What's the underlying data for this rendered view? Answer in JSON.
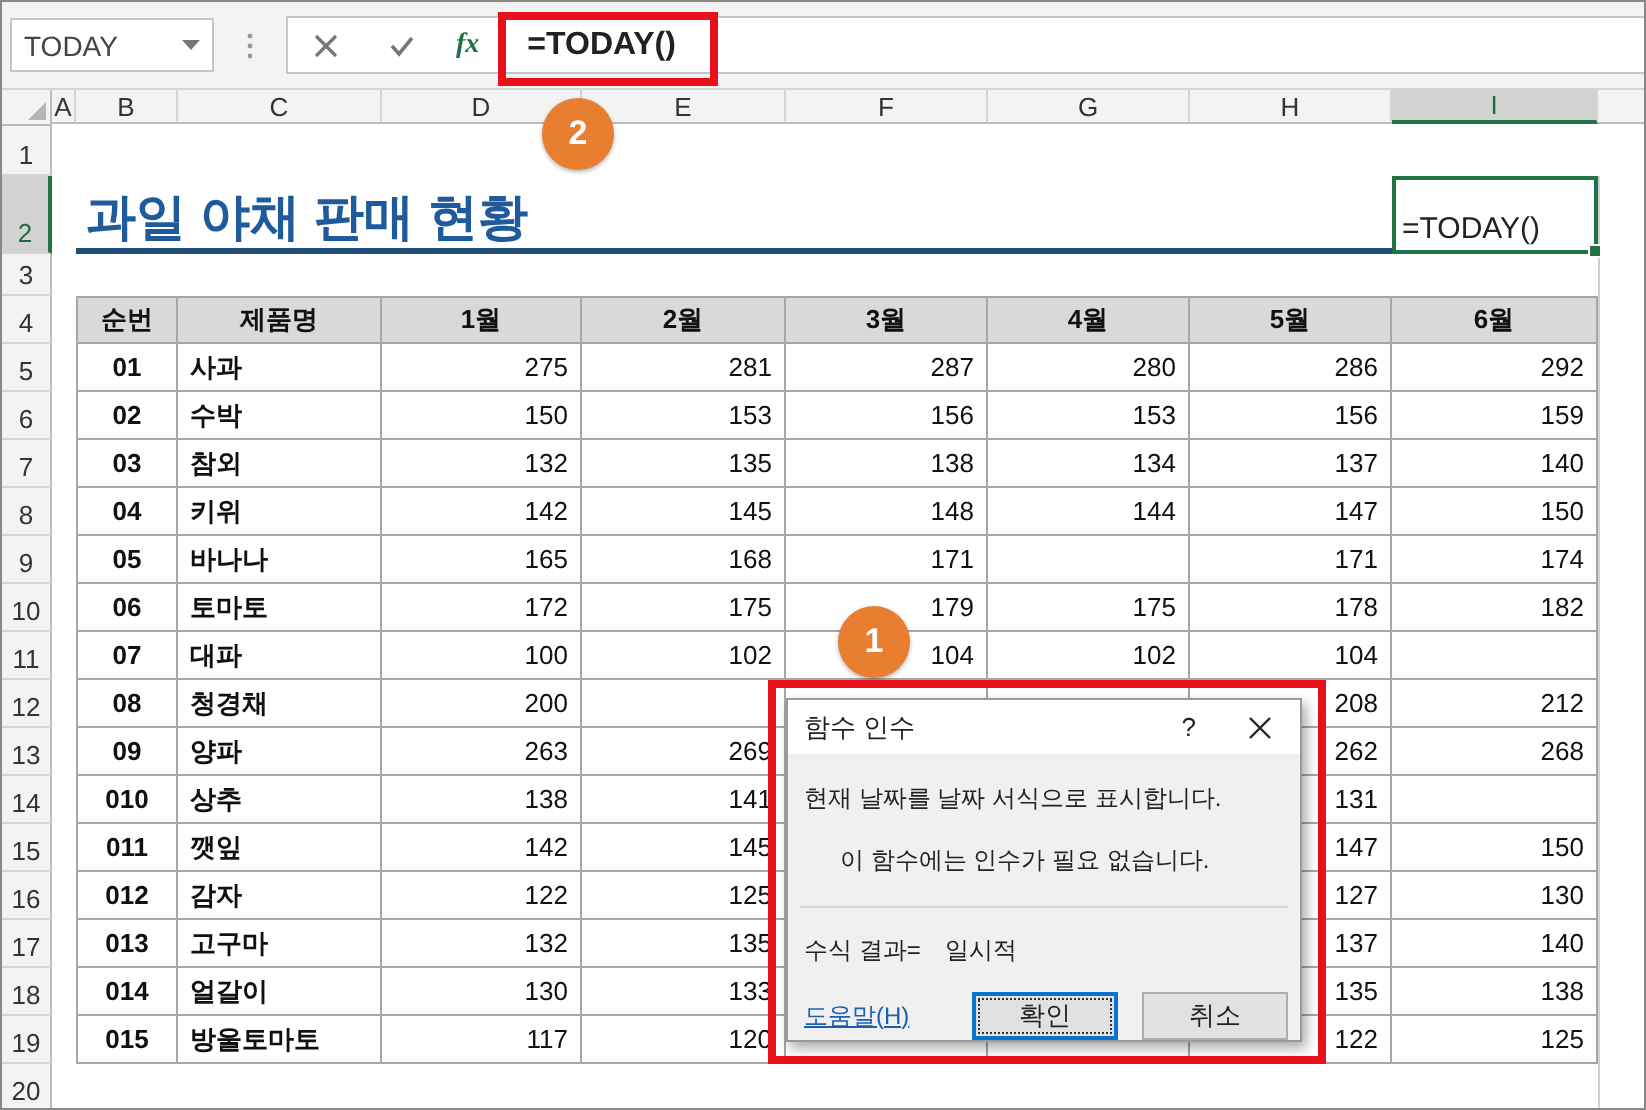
{
  "name_box": {
    "value": "TODAY"
  },
  "formula_bar": {
    "fx_label": "fx",
    "value": "=TODAY()"
  },
  "column_headers": [
    "A",
    "B",
    "C",
    "D",
    "E",
    "F",
    "G",
    "H",
    "I"
  ],
  "row_headers": [
    "1",
    "2",
    "3",
    "4",
    "5",
    "6",
    "7",
    "8",
    "9",
    "10",
    "11",
    "12",
    "13",
    "14",
    "15",
    "16",
    "17",
    "18",
    "19",
    "20"
  ],
  "title": "과일 야채 판매 현황",
  "selected_cell": {
    "value": "=TODAY()"
  },
  "table": {
    "columns": [
      "순번",
      "제품명",
      "1월",
      "2월",
      "3월",
      "4월",
      "5월",
      "6월"
    ],
    "rows": [
      [
        "01",
        "사과",
        "275",
        "281",
        "287",
        "280",
        "286",
        "292"
      ],
      [
        "02",
        "수박",
        "150",
        "153",
        "156",
        "153",
        "156",
        "159"
      ],
      [
        "03",
        "참외",
        "132",
        "135",
        "138",
        "134",
        "137",
        "140"
      ],
      [
        "04",
        "키위",
        "142",
        "145",
        "148",
        "144",
        "147",
        "150"
      ],
      [
        "05",
        "바나나",
        "165",
        "168",
        "171",
        null,
        "171",
        "174"
      ],
      [
        "06",
        "토마토",
        "172",
        "175",
        "179",
        "175",
        "178",
        "182"
      ],
      [
        "07",
        "대파",
        "100",
        "102",
        "104",
        "102",
        "104",
        null
      ],
      [
        "08",
        "청경채",
        "200",
        null,
        null,
        null,
        "208",
        "212"
      ],
      [
        "09",
        "양파",
        "263",
        "269",
        null,
        null,
        "262",
        "268"
      ],
      [
        "010",
        "상추",
        "138",
        "141",
        null,
        null,
        "131",
        null
      ],
      [
        "011",
        "깻잎",
        "142",
        "145",
        null,
        null,
        "147",
        "150"
      ],
      [
        "012",
        "감자",
        "122",
        "125",
        null,
        null,
        "127",
        "130"
      ],
      [
        "013",
        "고구마",
        "132",
        "135",
        null,
        null,
        "137",
        "140"
      ],
      [
        "014",
        "얼갈이",
        "130",
        "133",
        null,
        null,
        "135",
        "138"
      ],
      [
        "015",
        "방울토마토",
        "117",
        "120",
        null,
        null,
        "122",
        "125"
      ]
    ]
  },
  "dialog": {
    "title": "함수 인수",
    "help_mark": "?",
    "description": "현재 날짜를 날짜 서식으로 표시합니다.",
    "note": "이 함수에는 인수가 필요 없습니다.",
    "result_label": "수식 결과=",
    "result_value": "일시적",
    "help_link": "도움말(H)",
    "buttons": [
      {
        "label": "확인",
        "default": true
      },
      {
        "label": "취소",
        "default": false
      }
    ]
  },
  "callouts": [
    "1",
    "2"
  ]
}
